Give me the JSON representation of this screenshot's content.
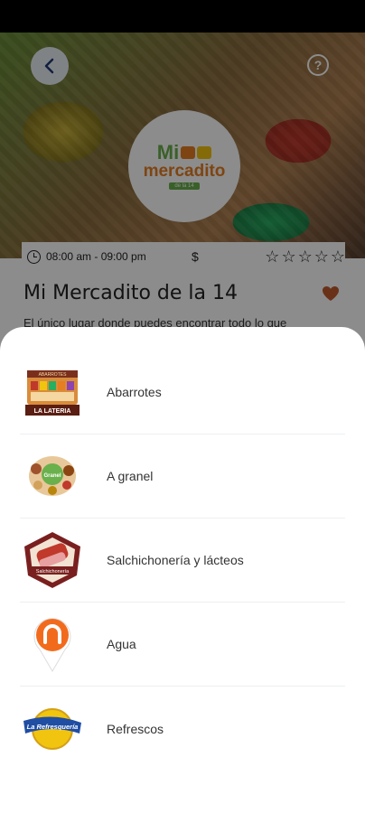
{
  "store": {
    "name": "Mi Mercadito de la 14",
    "hours": "08:00 am - 09:00 pm",
    "price_symbol": "$",
    "rating": 0,
    "rating_max": 5,
    "description": "El único lugar donde puedes encontrar todo lo que",
    "logo": {
      "line1": "Mi",
      "line2": "mercadito",
      "line3": "de la 14"
    },
    "favorite": true,
    "heart_color": "#c1592f"
  },
  "nav": {
    "back_icon": "chevron-left-icon",
    "help_label": "?"
  },
  "categories": [
    {
      "label": "Abarrotes",
      "icon": "la-lateria-logo",
      "icon_text": "LA LATERIA",
      "icon_top": "ABARROTES"
    },
    {
      "label": "A granel",
      "icon": "granel-logo",
      "icon_text": "Granel"
    },
    {
      "label": "Salchichonería y lácteos",
      "icon": "salchichoneria-logo",
      "icon_text": "Salchichonería"
    },
    {
      "label": "Agua",
      "icon": "water-pin-logo"
    },
    {
      "label": "Refrescos",
      "icon": "la-refresquería-logo",
      "icon_text": "La Refresquería"
    }
  ]
}
